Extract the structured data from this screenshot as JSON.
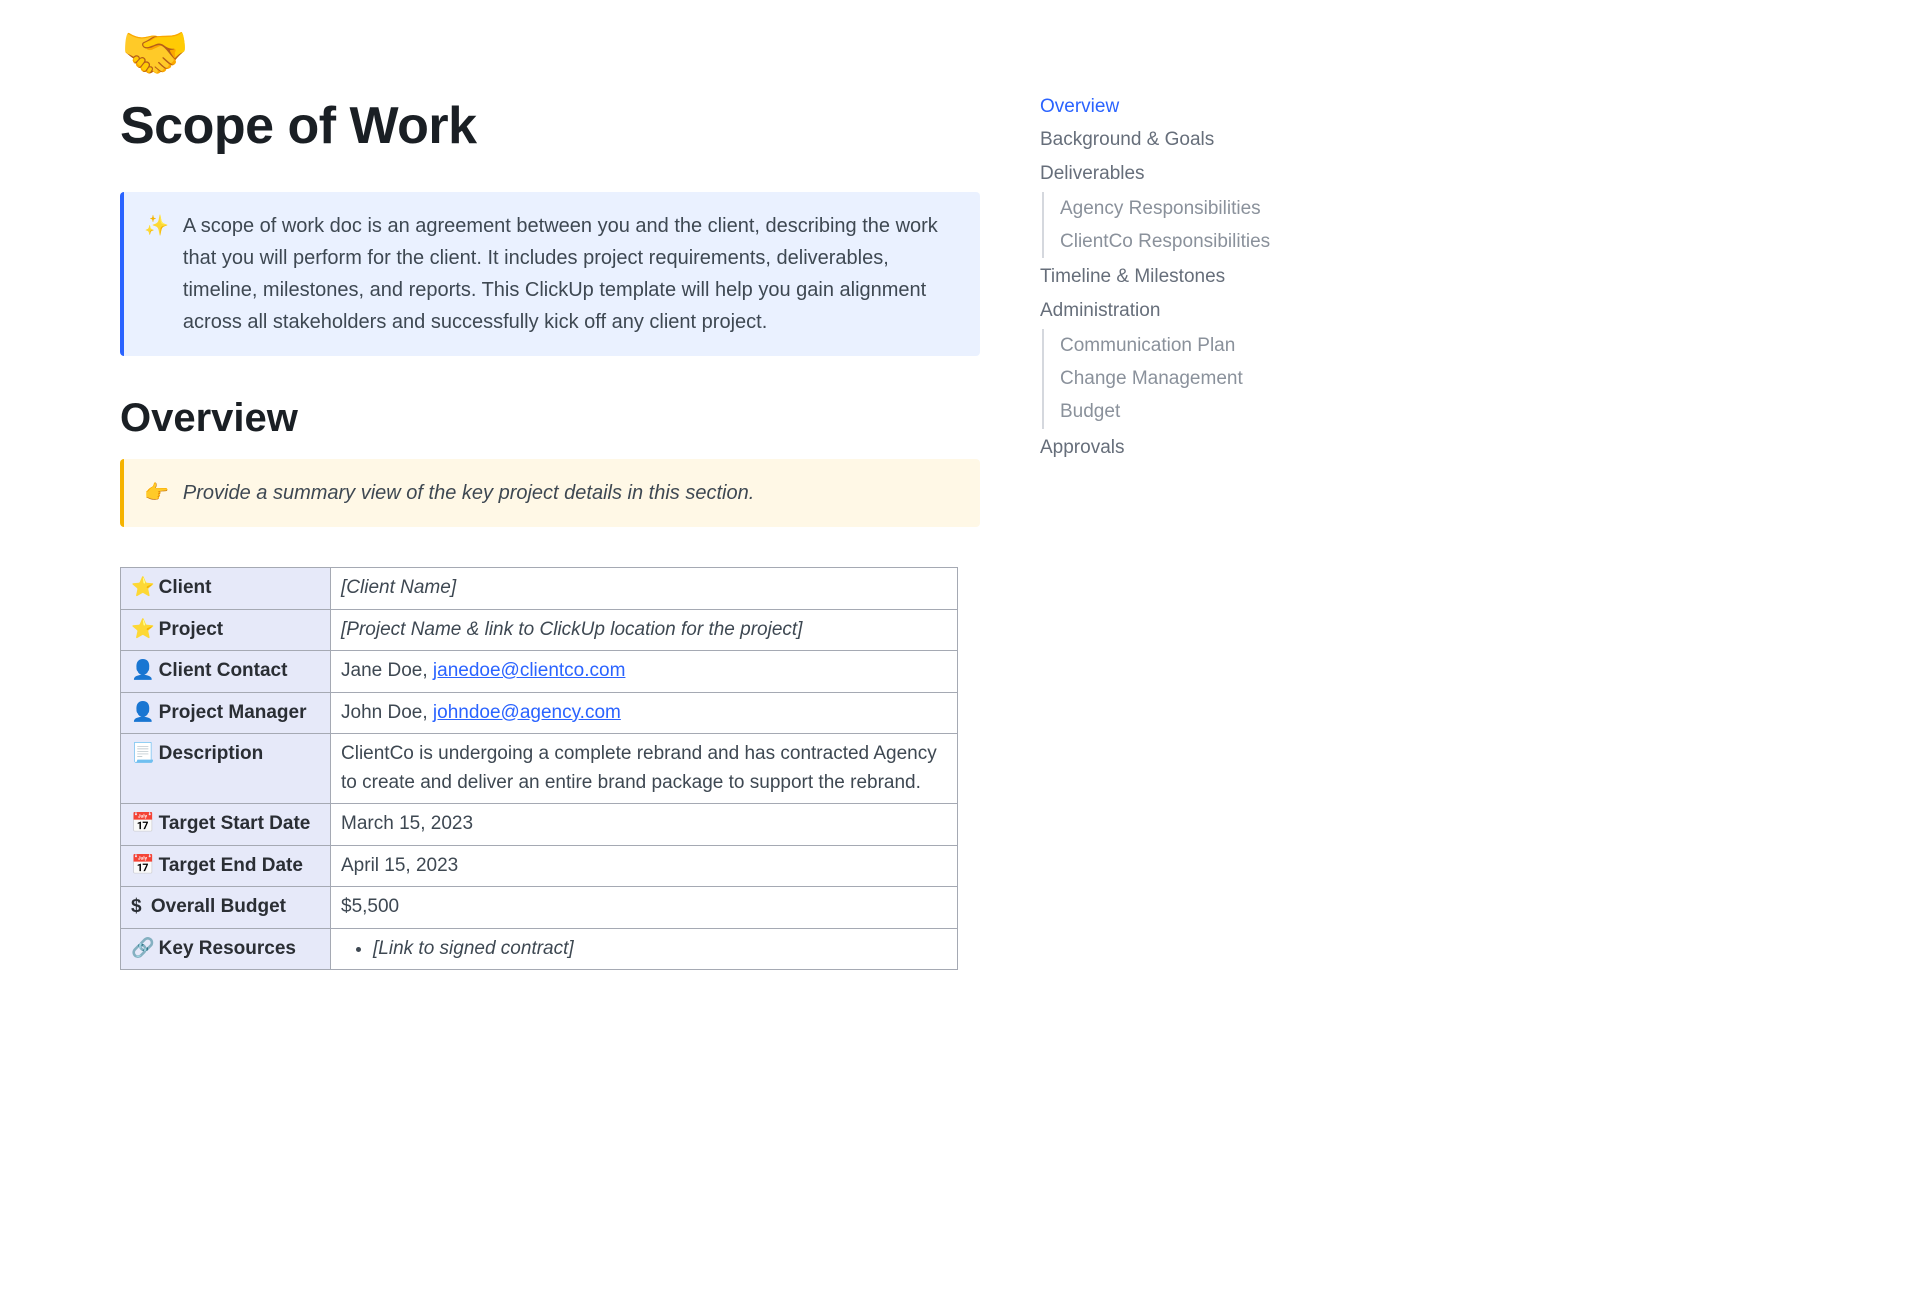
{
  "header": {
    "icon": "🤝",
    "title": "Scope of Work"
  },
  "intro_callout": {
    "emoji": "✨",
    "text": "A scope of work doc is an agreement between you and the client, describing the work that you will perform for the client. It includes project requirements, deliverables, timeline, milestones, and reports. This ClickUp template will help you gain alignment across all stakeholders and successfully kick off any client project."
  },
  "overview": {
    "heading": "Overview",
    "hint": {
      "emoji": "👉",
      "text": "Provide a summary view of the key project details in this section."
    },
    "rows": {
      "client": {
        "icon": "⭐",
        "label": "Client",
        "value": "[Client Name]"
      },
      "project": {
        "icon": "⭐",
        "label": "Project",
        "value": "[Project Name & link to ClickUp location for the project]"
      },
      "client_contact": {
        "icon": "👤",
        "label": "Client Contact",
        "name": "Jane Doe, ",
        "email": "janedoe@clientco.com"
      },
      "project_manager": {
        "icon": "👤",
        "label": "Project Manager",
        "name": "John Doe, ",
        "email": "johndoe@agency.com"
      },
      "description": {
        "icon": "📃",
        "label": "Description",
        "value": "ClientCo is undergoing a complete rebrand and has contracted Agency to create and deliver an entire brand package to support the rebrand."
      },
      "start_date": {
        "icon": "📅",
        "label": "Target Start Date",
        "value": "March 15, 2023"
      },
      "end_date": {
        "icon": "📅",
        "label": "Target End Date",
        "value": "April 15, 2023"
      },
      "budget": {
        "icon": "$",
        "label": "Overall Budget",
        "value": "$5,500"
      },
      "resources": {
        "icon": "🔗",
        "label": "Key Resources",
        "item1": "[Link to signed contract]"
      }
    }
  },
  "toc": {
    "items": [
      {
        "label": "Overview",
        "active": true
      },
      {
        "label": "Background & Goals"
      },
      {
        "label": "Deliverables",
        "children": [
          "Agency Responsibilities",
          "ClientCo Responsibilities"
        ]
      },
      {
        "label": "Timeline & Milestones"
      },
      {
        "label": "Administration",
        "children": [
          "Communication Plan",
          "Change Management",
          "Budget"
        ]
      },
      {
        "label": "Approvals"
      }
    ],
    "flat": {
      "overview": "Overview",
      "background": "Background & Goals",
      "deliverables": "Deliverables",
      "agency_resp": "Agency Responsibilities",
      "clientco_resp": "ClientCo Responsibilities",
      "timeline": "Timeline & Milestones",
      "administration": "Administration",
      "comm_plan": "Communication Plan",
      "change_mgmt": "Change Management",
      "budget": "Budget",
      "approvals": "Approvals"
    }
  }
}
